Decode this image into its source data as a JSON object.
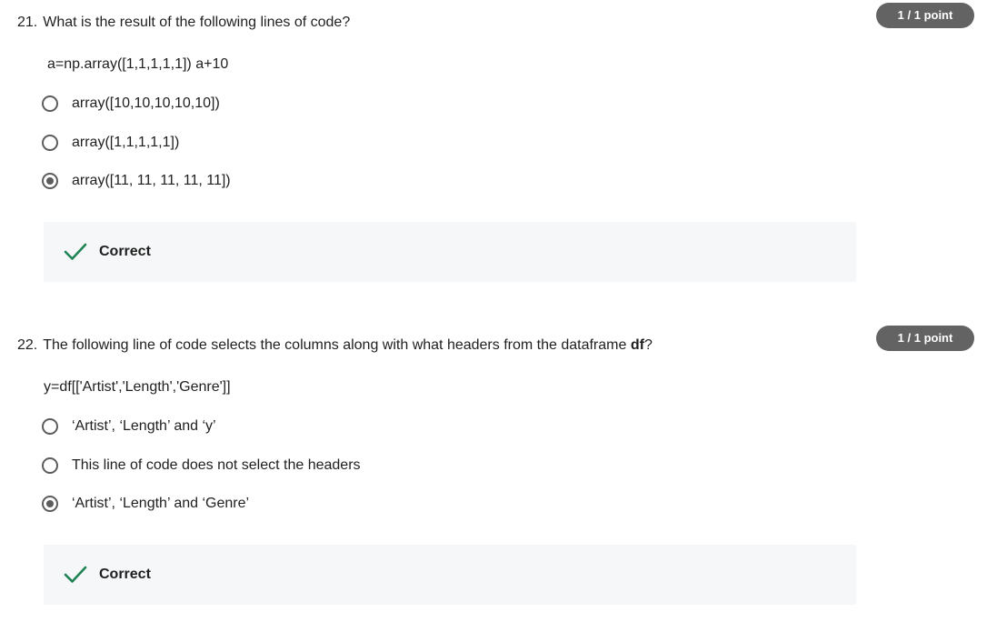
{
  "questions": [
    {
      "number": "21.",
      "prompt": "What is the result of the following lines of code?",
      "prompt_bold": "",
      "prompt_end": "",
      "points": "1 / 1 point",
      "code": "a=np.array([1,1,1,1,1]) a+10",
      "options": [
        {
          "label": "array([10,10,10,10,10])",
          "selected": false
        },
        {
          "label": "array([1,1,1,1,1])",
          "selected": false
        },
        {
          "label": "array([11, 11, 11, 11, 11])",
          "selected": true
        }
      ],
      "feedback": "Correct"
    },
    {
      "number": "22.",
      "prompt": "The following line of code selects the columns along with what headers from the dataframe ",
      "prompt_bold": "df",
      "prompt_end": "?",
      "points": "1 / 1 point",
      "code": "y=df[['Artist','Length','Genre']]",
      "options": [
        {
          "label": "‘Artist’, ‘Length’ and ‘y’",
          "selected": false
        },
        {
          "label": "This line of code does not select the headers",
          "selected": false
        },
        {
          "label": "‘Artist’, ‘Length’ and ‘Genre’",
          "selected": true
        }
      ],
      "feedback": "Correct"
    }
  ],
  "colors": {
    "badge": "#636363",
    "check": "#1f8354",
    "feedback_bg": "#f5f7f8",
    "radio": "#5c5c5c"
  },
  "icons": {
    "feedback": "check-icon"
  }
}
